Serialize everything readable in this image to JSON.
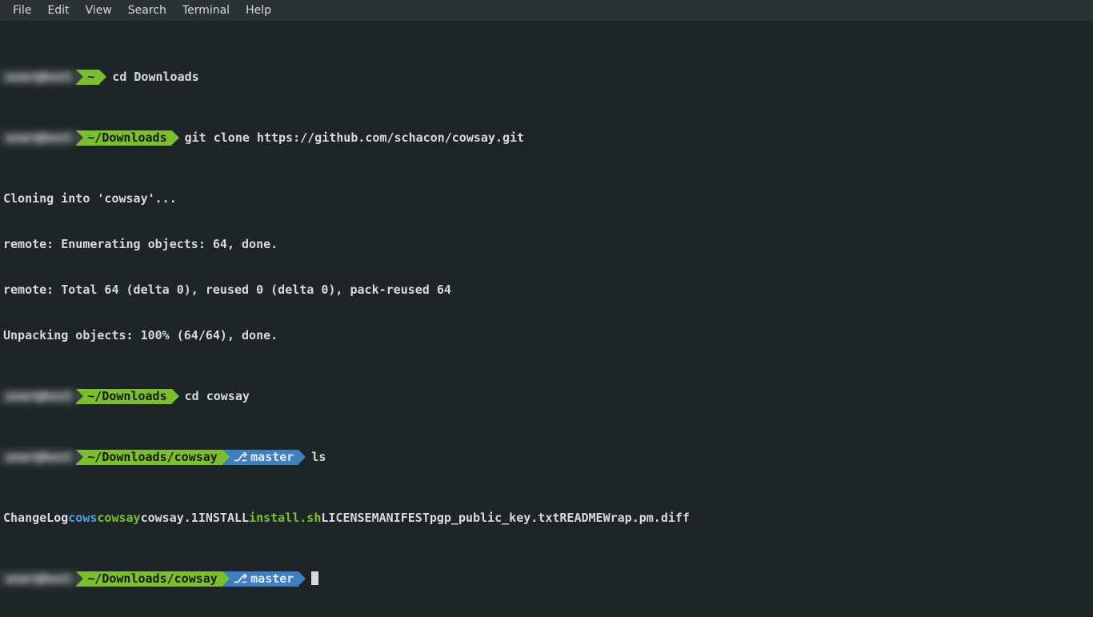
{
  "menubar": {
    "items": [
      "File",
      "Edit",
      "View",
      "Search",
      "Terminal",
      "Help"
    ]
  },
  "prompts": [
    {
      "user": "user@host",
      "path": "~",
      "branch": null,
      "cmd": "cd Downloads"
    },
    {
      "user": "user@host",
      "path": "~/Downloads",
      "branch": null,
      "cmd": "git clone https://github.com/schacon/cowsay.git"
    }
  ],
  "clone_output": [
    "Cloning into 'cowsay'...",
    "remote: Enumerating objects: 64, done.",
    "remote: Total 64 (delta 0), reused 0 (delta 0), pack-reused 64",
    "Unpacking objects: 100% (64/64), done."
  ],
  "prompts2": [
    {
      "user": "user@host",
      "path": "~/Downloads",
      "branch": null,
      "cmd": "cd cowsay"
    },
    {
      "user": "user@host",
      "path": "~/Downloads/cowsay",
      "branch": "master",
      "cmd": "ls"
    }
  ],
  "ls_output": [
    {
      "name": "ChangeLog",
      "type": "file"
    },
    {
      "name": "cows",
      "type": "dir"
    },
    {
      "name": "cowsay",
      "type": "exec"
    },
    {
      "name": "cowsay.1",
      "type": "file"
    },
    {
      "name": "INSTALL",
      "type": "file"
    },
    {
      "name": "install.sh",
      "type": "exec"
    },
    {
      "name": "LICENSE",
      "type": "file"
    },
    {
      "name": "MANIFEST",
      "type": "file"
    },
    {
      "name": "pgp_public_key.txt",
      "type": "file"
    },
    {
      "name": "README",
      "type": "file"
    },
    {
      "name": "Wrap.pm.diff",
      "type": "file"
    }
  ],
  "final_prompt": {
    "user": "user@host",
    "path": "~/Downloads/cowsay",
    "branch": "master",
    "cmd": ""
  },
  "branch_glyph": "⎇"
}
